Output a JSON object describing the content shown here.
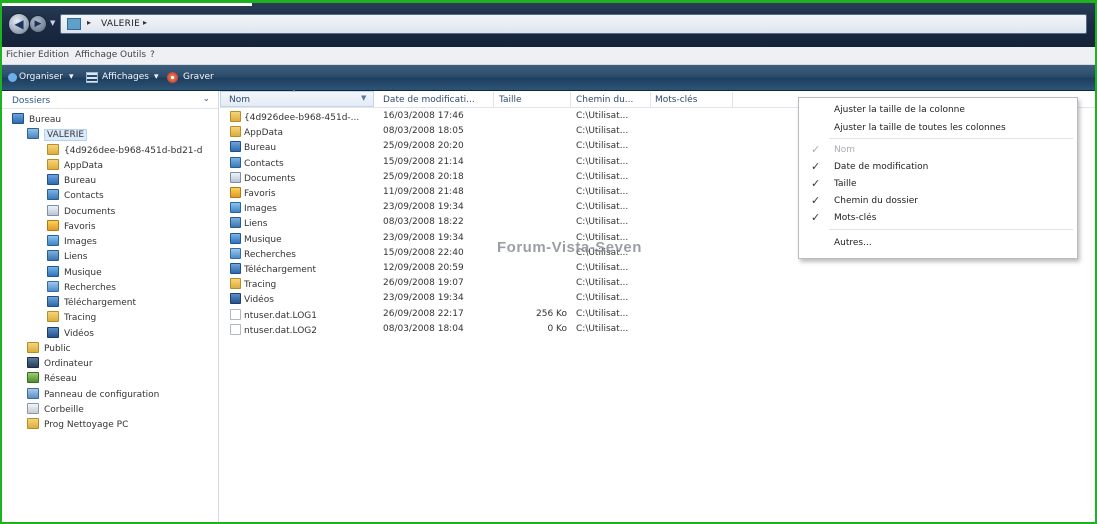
{
  "address_bar": {
    "path_segments": [
      "VALERIE"
    ],
    "separator": "▸",
    "folder_icon": "folder-icon",
    "back_icon": "back-arrow-icon",
    "forward_icon": "forward-arrow-icon"
  },
  "menu_bar": {
    "items": [
      "Fichier",
      "Edition",
      "Affichage",
      "Outils",
      "?"
    ]
  },
  "command_bar": {
    "organiser": "Organiser",
    "affichages": "Affichages",
    "graver": "Graver",
    "dropdown_glyph": "▾"
  },
  "navigation_pane": {
    "header": "Dossiers",
    "items": [
      {
        "label": "Bureau",
        "icon": "desktop-icon"
      },
      {
        "label": "VALERIE",
        "icon": "user-folder-icon",
        "selected": true
      },
      {
        "label": "{4d926dee-b968-451d-bd21-d",
        "icon": "folder-icon"
      },
      {
        "label": "AppData",
        "icon": "folder-icon"
      },
      {
        "label": "Bureau",
        "icon": "desktop-icon"
      },
      {
        "label": "Contacts",
        "icon": "contacts-icon"
      },
      {
        "label": "Documents",
        "icon": "documents-icon"
      },
      {
        "label": "Favoris",
        "icon": "favorites-icon"
      },
      {
        "label": "Images",
        "icon": "images-icon"
      },
      {
        "label": "Liens",
        "icon": "links-icon"
      },
      {
        "label": "Musique",
        "icon": "music-icon"
      },
      {
        "label": "Recherches",
        "icon": "searches-icon"
      },
      {
        "label": "Téléchargement",
        "icon": "downloads-icon"
      },
      {
        "label": "Tracing",
        "icon": "folder-icon"
      },
      {
        "label": "Vidéos",
        "icon": "videos-icon"
      },
      {
        "label": "Public",
        "icon": "folder-icon"
      },
      {
        "label": "Ordinateur",
        "icon": "computer-icon"
      },
      {
        "label": "Réseau",
        "icon": "network-icon"
      },
      {
        "label": "Panneau de configuration",
        "icon": "control-panel-icon"
      },
      {
        "label": "Corbeille",
        "icon": "recycle-bin-icon"
      },
      {
        "label": "Prog Nettoyage PC",
        "icon": "folder-icon"
      }
    ]
  },
  "columns": {
    "nom": "Nom",
    "date": "Date de modificati...",
    "taille": "Taille",
    "chemin": "Chemin du...",
    "mots_cles": "Mots-clés"
  },
  "files": [
    {
      "name": "{4d926dee-b968-451d-...",
      "date": "16/03/2008 17:46",
      "size": "",
      "path": "C:\\Utilisat...",
      "icon": "folder-icon"
    },
    {
      "name": "AppData",
      "date": "08/03/2008 18:05",
      "size": "",
      "path": "C:\\Utilisat...",
      "icon": "folder-icon"
    },
    {
      "name": "Bureau",
      "date": "25/09/2008 20:20",
      "size": "",
      "path": "C:\\Utilisat...",
      "icon": "desktop-icon"
    },
    {
      "name": "Contacts",
      "date": "15/09/2008 21:14",
      "size": "",
      "path": "C:\\Utilisat...",
      "icon": "contacts-icon"
    },
    {
      "name": "Documents",
      "date": "25/09/2008 20:18",
      "size": "",
      "path": "C:\\Utilisat...",
      "icon": "documents-icon"
    },
    {
      "name": "Favoris",
      "date": "11/09/2008 21:48",
      "size": "",
      "path": "C:\\Utilisat...",
      "icon": "favorites-icon"
    },
    {
      "name": "Images",
      "date": "23/09/2008 19:34",
      "size": "",
      "path": "C:\\Utilisat...",
      "icon": "images-icon"
    },
    {
      "name": "Liens",
      "date": "08/03/2008 18:22",
      "size": "",
      "path": "C:\\Utilisat...",
      "icon": "links-icon"
    },
    {
      "name": "Musique",
      "date": "23/09/2008 19:34",
      "size": "",
      "path": "C:\\Utilisat...",
      "icon": "music-icon"
    },
    {
      "name": "Recherches",
      "date": "15/09/2008 22:40",
      "size": "",
      "path": "C:\\Utilisat...",
      "icon": "searches-icon"
    },
    {
      "name": "Téléchargement",
      "date": "12/09/2008 20:59",
      "size": "",
      "path": "C:\\Utilisat...",
      "icon": "downloads-icon"
    },
    {
      "name": "Tracing",
      "date": "26/09/2008 19:07",
      "size": "",
      "path": "C:\\Utilisat...",
      "icon": "folder-icon"
    },
    {
      "name": "Vidéos",
      "date": "23/09/2008 19:34",
      "size": "",
      "path": "C:\\Utilisat...",
      "icon": "videos-icon"
    },
    {
      "name": "ntuser.dat.LOG1",
      "date": "26/09/2008 22:17",
      "size": "256 Ko",
      "path": "C:\\Utilisat...",
      "icon": "file-icon"
    },
    {
      "name": "ntuser.dat.LOG2",
      "date": "08/03/2008 18:04",
      "size": "0 Ko",
      "path": "C:\\Utilisat...",
      "icon": "file-icon"
    }
  ],
  "watermark": "Forum-Vista-Seven",
  "context_menu": {
    "items": [
      {
        "label": "Ajuster la taille de la colonne",
        "checked": false,
        "disabled": false
      },
      {
        "label": "Ajuster la taille de toutes les colonnes",
        "checked": false,
        "disabled": false
      },
      {
        "label": "Nom",
        "checked": true,
        "disabled": true
      },
      {
        "label": "Date de modification",
        "checked": true,
        "disabled": false
      },
      {
        "label": "Taille",
        "checked": true,
        "disabled": false
      },
      {
        "label": "Chemin du dossier",
        "checked": true,
        "disabled": false
      },
      {
        "label": "Mots-clés",
        "checked": true,
        "disabled": false
      },
      {
        "label": "Autres...",
        "checked": false,
        "disabled": false
      }
    ],
    "check_glyph": "✓"
  },
  "colors": {
    "frame": "#1fb21f",
    "folder": "#e8c357",
    "blue_item": "#4a7fc0",
    "selection": "#dcebfc"
  }
}
